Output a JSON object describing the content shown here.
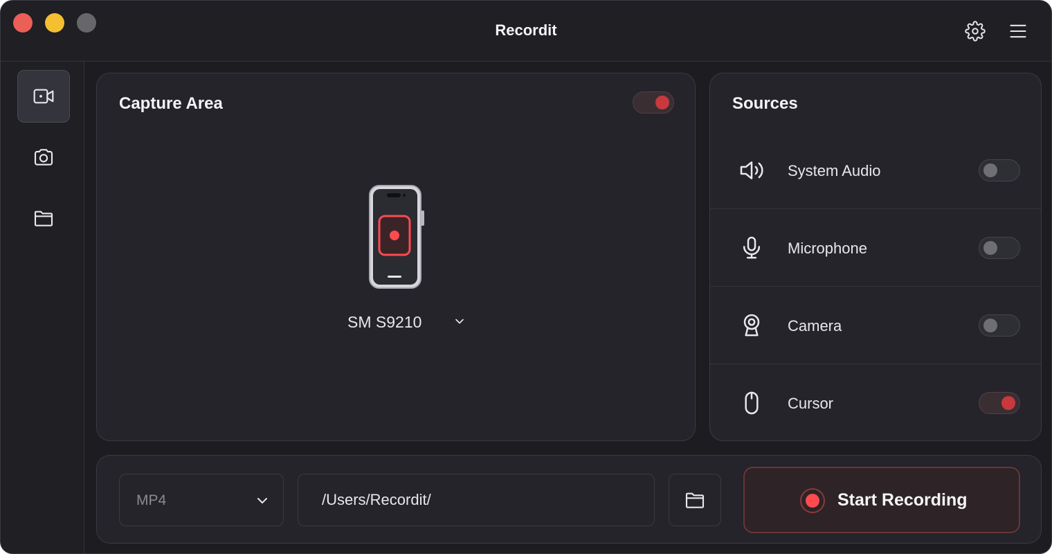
{
  "window": {
    "title": "Recordit"
  },
  "sidebar": {
    "items": [
      {
        "id": "video",
        "icon": "video-camera-icon",
        "active": true
      },
      {
        "id": "screenshot",
        "icon": "camera-icon",
        "active": false
      },
      {
        "id": "files",
        "icon": "folder-icon",
        "active": false
      }
    ]
  },
  "capture": {
    "title": "Capture Area",
    "enabled": true,
    "device_name": "SM S9210"
  },
  "sources": {
    "title": "Sources",
    "items": [
      {
        "label": "System Audio",
        "icon": "speaker-icon",
        "enabled": false
      },
      {
        "label": "Microphone",
        "icon": "microphone-icon",
        "enabled": false
      },
      {
        "label": "Camera",
        "icon": "webcam-icon",
        "enabled": false
      },
      {
        "label": "Cursor",
        "icon": "mouse-icon",
        "enabled": true
      }
    ]
  },
  "output": {
    "format": "MP4",
    "path": "/Users/Recordit/"
  },
  "record_button": {
    "label": "Start Recording"
  },
  "colors": {
    "accent_red": "#ff4a4f",
    "window_bg": "#1c1c21",
    "panel_bg": "#24242a"
  }
}
